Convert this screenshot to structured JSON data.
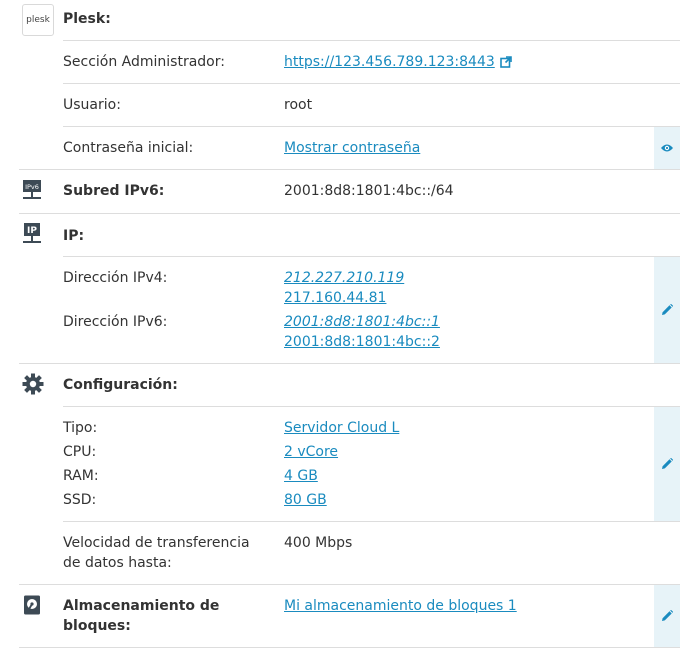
{
  "plesk": {
    "logo_text": "plesk",
    "title": "Plesk:",
    "admin_label": "Sección Administrador:",
    "admin_url": "https://123.456.789.123:8443",
    "user_label": "Usuario:",
    "user_value": "root",
    "password_label": "Contraseña inicial:",
    "password_link": "Mostrar contraseña"
  },
  "subnet": {
    "icon_text": "IPv6",
    "label": "Subred IPv6:",
    "value": "2001:8d8:1801:4bc::/64"
  },
  "ip": {
    "icon_text": "IP",
    "title": "IP:",
    "ipv4_label": "Dirección IPv4:",
    "ipv4": [
      "212.227.210.119",
      "217.160.44.81"
    ],
    "ipv6_label": "Dirección IPv6:",
    "ipv6": [
      "2001:8d8:1801:4bc::1",
      "2001:8d8:1801:4bc::2"
    ]
  },
  "config": {
    "title": "Configuración:",
    "type_label": "Tipo:",
    "type_value": "Servidor Cloud L",
    "cpu_label": "CPU:",
    "cpu_value": "2 vCore",
    "ram_label": "RAM:",
    "ram_value": "4 GB",
    "ssd_label": "SSD:",
    "ssd_value": "80 GB",
    "speed_label_line1": "Velocidad de transferencia",
    "speed_label_line2": "de datos hasta:",
    "speed_value": "400 Mbps"
  },
  "storage": {
    "label_line1": "Almacenamiento de",
    "label_line2": "bloques:",
    "value": "Mi almacenamiento de bloques 1"
  },
  "colors": {
    "link": "#1a8bbf",
    "edit_bg": "#e7f3f8",
    "divider": "#dddddd",
    "icon_dark": "#3d4a55"
  }
}
